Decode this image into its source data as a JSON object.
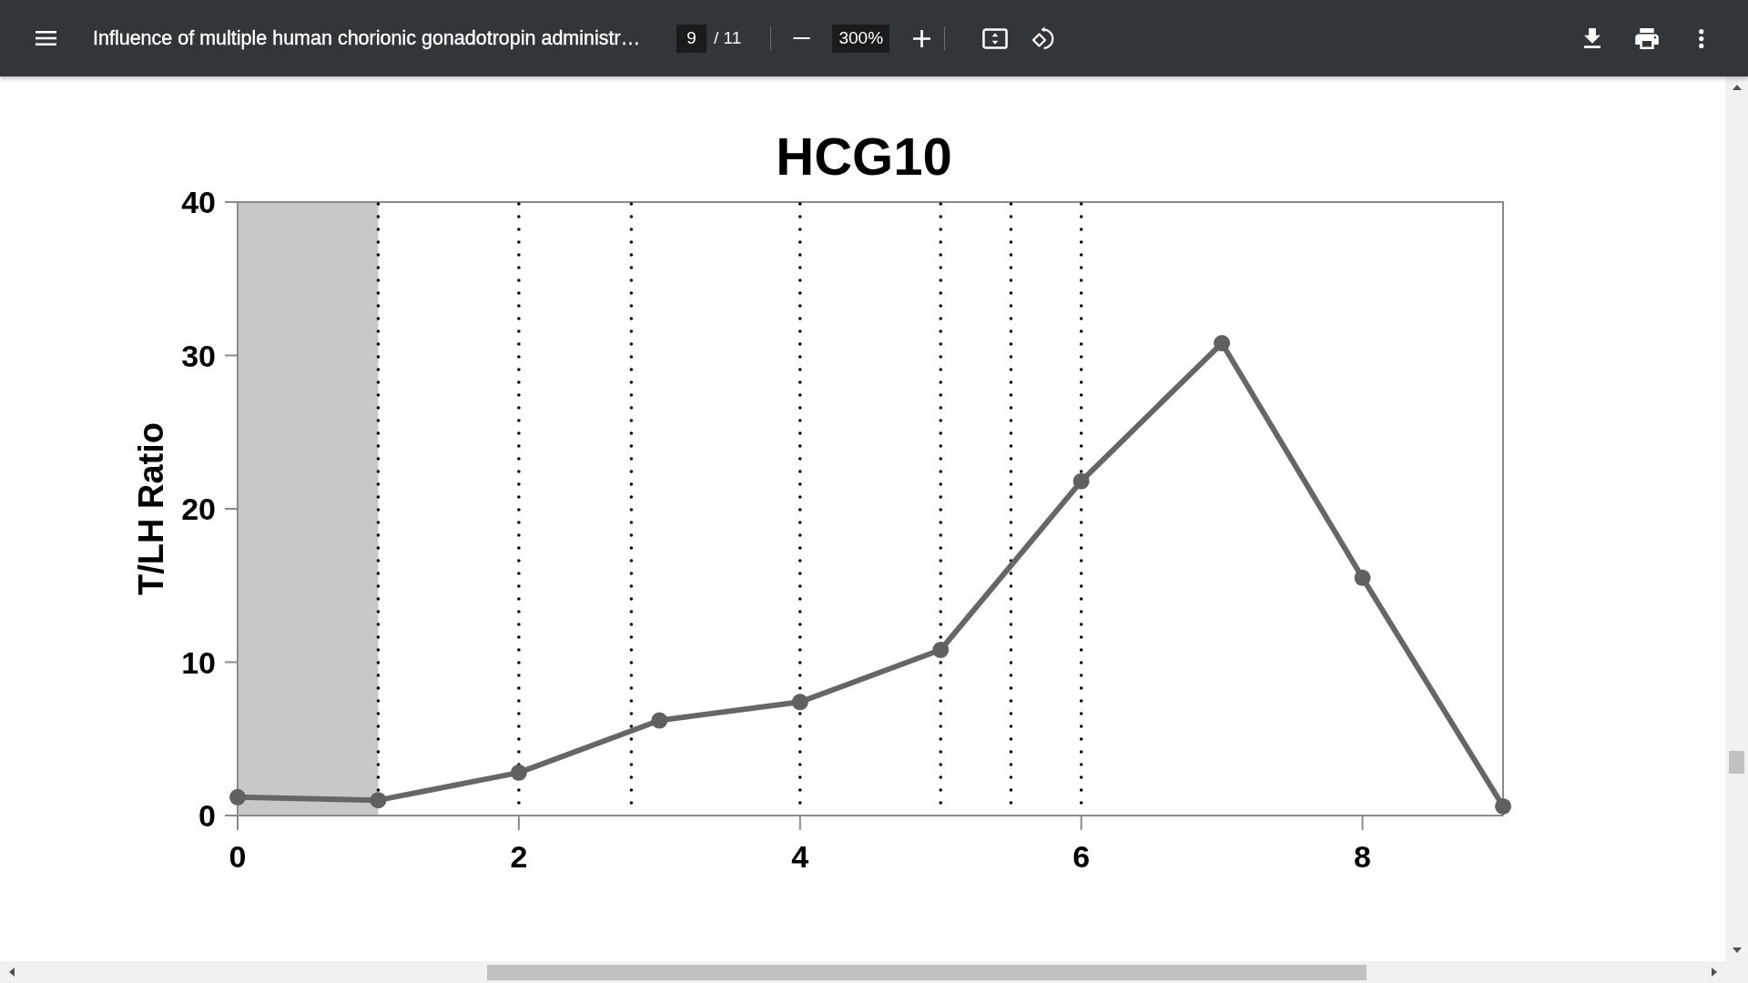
{
  "toolbar": {
    "title": "Influence of multiple human chorionic gonadotropin administr…",
    "page_field": {
      "value": "9"
    },
    "page_count": "/ 11",
    "zoom_field": {
      "value": "300%"
    }
  },
  "figure": {
    "chart_data": {
      "type": "line",
      "title": "HCG10",
      "ylabel": "T/LH Ratio",
      "x": [
        0,
        1,
        2,
        3,
        4,
        5,
        6,
        7,
        8,
        9
      ],
      "values": [
        1.2,
        1.0,
        2.8,
        6.2,
        7.4,
        10.8,
        21.8,
        30.8,
        15.5,
        0.6
      ],
      "marker": "circle",
      "xlim": [
        0,
        9
      ],
      "ylim": [
        0,
        40
      ],
      "xticks": [
        0,
        2,
        4,
        6,
        8
      ],
      "yticks": [
        0,
        10,
        20,
        30,
        40
      ],
      "bands": [
        {
          "axis": "x",
          "from": 0,
          "to": 1
        }
      ],
      "ref_lines": [
        {
          "axis": "x",
          "value": 1
        },
        {
          "axis": "x",
          "value": 2
        },
        {
          "axis": "x",
          "value": 2.8
        },
        {
          "axis": "x",
          "value": 4
        },
        {
          "axis": "x",
          "value": 5
        },
        {
          "axis": "x",
          "value": 5.5
        },
        {
          "axis": "x",
          "value": 6
        }
      ]
    }
  }
}
